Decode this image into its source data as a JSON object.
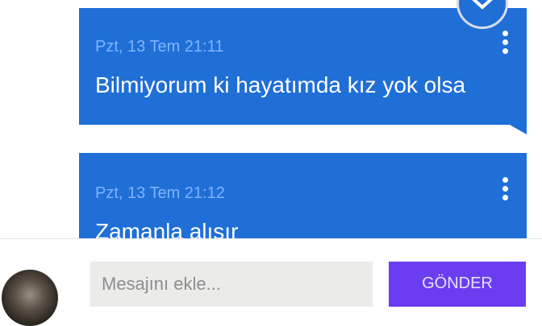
{
  "messages": [
    {
      "timestamp": "Pzt, 13 Tem 21:11",
      "text": "Bilmiyorum ki hayatımda kız yok olsa"
    },
    {
      "timestamp": "Pzt, 13 Tem 21:12",
      "text": "Zamanla alışır"
    }
  ],
  "composer": {
    "placeholder": "Mesajını ekle...",
    "send_label": "GÖNDER"
  },
  "colors": {
    "bubble": "#1f6fd6",
    "timestamp": "#7fb3ff",
    "send_button": "#6a3df0",
    "input_bg": "#ebebe9"
  },
  "icons": [
    "close-icon",
    "more-vertical-icon",
    "avatar"
  ]
}
